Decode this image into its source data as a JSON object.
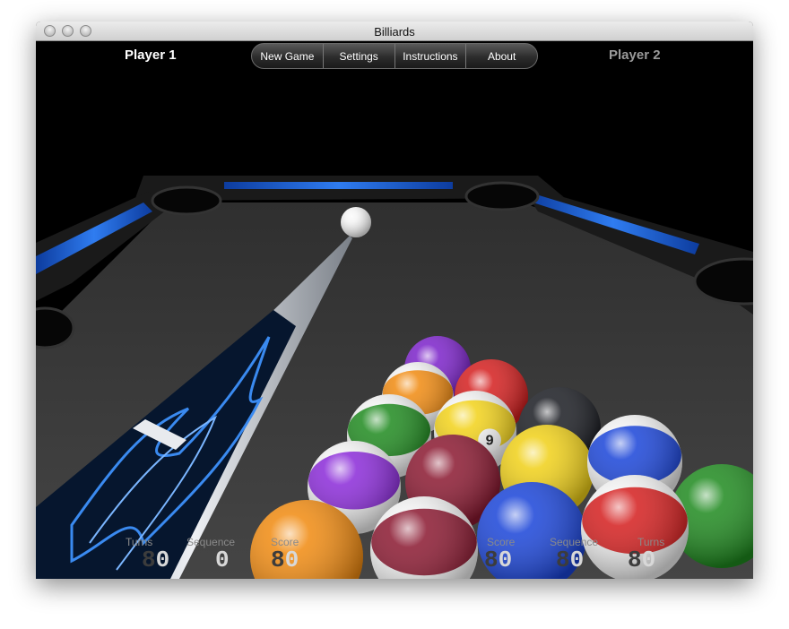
{
  "window": {
    "title": "Billiards"
  },
  "players": {
    "p1": "Player 1",
    "p2": "Player 2"
  },
  "menu": [
    {
      "label": "New Game"
    },
    {
      "label": "Settings"
    },
    {
      "label": "Instructions"
    },
    {
      "label": "About"
    }
  ],
  "stats_left": {
    "turns": {
      "label": "Turns",
      "value": "0"
    },
    "sequence": {
      "label": "Sequence",
      "value": "0"
    },
    "score": {
      "label": "Score",
      "value": "0"
    }
  },
  "stats_right": {
    "score": {
      "label": "Score",
      "value": "0"
    },
    "sequence": {
      "label": "Sequence",
      "value": "0"
    },
    "turns": {
      "label": "Turns",
      "value": "0"
    }
  },
  "balls": [
    {
      "name": "ball-purple-back",
      "color": "#7b22c9",
      "stripe": false
    },
    {
      "name": "ball-orange-stripe",
      "color": "#f08a10",
      "stripe": true
    },
    {
      "name": "ball-red",
      "color": "#d41e1e",
      "stripe": false
    },
    {
      "name": "ball-green-stripe",
      "color": "#1f8a1f",
      "stripe": true
    },
    {
      "name": "ball-yellow-stripe-9",
      "color": "#f2d21a",
      "stripe": true,
      "number": "9"
    },
    {
      "name": "ball-black-8",
      "color": "#1a1c22",
      "stripe": false
    },
    {
      "name": "ball-purple-stripe",
      "color": "#8a2ad8",
      "stripe": true
    },
    {
      "name": "ball-maroon",
      "color": "#8a1830",
      "stripe": false
    },
    {
      "name": "ball-yellow",
      "color": "#f0d018",
      "stripe": false
    },
    {
      "name": "ball-blue-stripe",
      "color": "#1a44d8",
      "stripe": true
    },
    {
      "name": "ball-green-right",
      "color": "#1f8a1f",
      "stripe": false
    },
    {
      "name": "ball-orange-front",
      "color": "#f08a10",
      "stripe": false
    },
    {
      "name": "ball-maroon-stripe",
      "color": "#8a1830",
      "stripe": true
    },
    {
      "name": "ball-blue",
      "color": "#1a44d8",
      "stripe": false
    },
    {
      "name": "ball-red-stripe",
      "color": "#d41e1e",
      "stripe": true
    },
    {
      "name": "cue-ball",
      "color": "#f4f4f4",
      "stripe": false
    }
  ],
  "colors": {
    "felt": "#3a3a3a",
    "rail_blue": "#1e5fd8",
    "cushion": "#1b1b1b"
  }
}
